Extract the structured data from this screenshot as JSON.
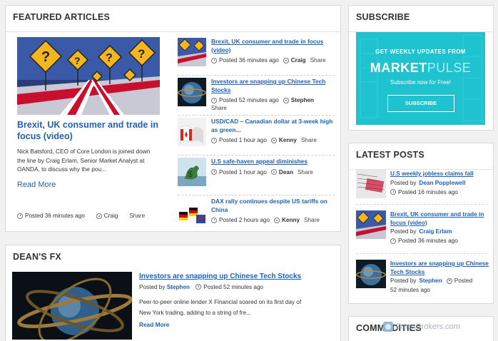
{
  "featured": {
    "title": "FEATURED ARTICLES",
    "hero": {
      "title": "Brexit, UK consumer and trade in focus (video)",
      "description": "Nick Batsford, CEO of Core London is joined down the line by Craig Erlam, Senior Market Analyst at OANDA, to discuss why the pou...",
      "read_more": "Read More",
      "time": "Posted 36 minutes ago",
      "author": "Craig",
      "share": "Share"
    },
    "items": [
      {
        "title": "Brexit, UK consumer and trade in focus (video)",
        "time": "Posted 36 minutes ago",
        "author": "Craig",
        "share": "Share"
      },
      {
        "title": "Investors are snapping up Chinese Tech Stocks",
        "time": "Posted 52 minutes ago",
        "author": "Stephen",
        "share": "Share"
      },
      {
        "title": "USD/CAD – Canadian dollar at 3-week high as green...",
        "time": "Posted 1 hour ago",
        "author": "Kenny",
        "share": "Share"
      },
      {
        "title": "U.S safe-haven appeal diminishes",
        "time": "Posted 1 hour ago",
        "author": "Dean",
        "share": "Share"
      },
      {
        "title": "DAX rally continues despite US tariffs on China",
        "time": "Posted 2 hours ago",
        "author": "Kenny",
        "share": "Share"
      }
    ]
  },
  "deans": {
    "title": "DEAN'S FX",
    "article_title": "Investors are snapping up Chinese Tech Stocks",
    "posted_by": "Posted by",
    "author": "Stephen",
    "time": "Posted 52 minutes ago",
    "description": "Peer-to-peer online lender X Financial soared on its first day of New York trading, adding to a string of fre...",
    "read_more": "Read More"
  },
  "subscribe": {
    "title": "SUBSCRIBE",
    "get": "GET  WEEKLY UPDATES FROM",
    "logo_a": "MARKET",
    "logo_b": "PULSE",
    "free": "Subscribe now for Free!",
    "button": "SUBSCRIBE"
  },
  "latest": {
    "title": "LATEST POSTS",
    "posted_by": "Posted by",
    "items": [
      {
        "title": "U.S weekly jobless claims fall",
        "author": "Dean Popplewell",
        "time": "Posted 16 minutes ago"
      },
      {
        "title": "Brexit, UK consumer and trade in focus (video)",
        "author": "Craig Erlam",
        "time": "Posted 36 minutes ago"
      },
      {
        "title": "Investors are snapping up Chinese Tech Stocks",
        "author": "Stephen",
        "time_a": "Posted",
        "time_b": "52 minutes ago"
      }
    ]
  },
  "commodities": {
    "title": "COMMODITIES"
  },
  "watermark": {
    "text": "ForexBrokers.com"
  }
}
